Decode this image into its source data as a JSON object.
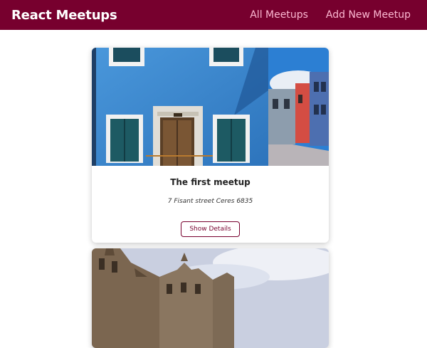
{
  "header": {
    "logo": "React Meetups",
    "nav": [
      {
        "label": "All Meetups"
      },
      {
        "label": "Add New Meetup"
      }
    ]
  },
  "meetups": [
    {
      "title": "The first meetup",
      "address": "7 Fisant street Ceres 6835",
      "button_label": "Show Details"
    }
  ],
  "colors": {
    "brand": "#77002e",
    "nav_link": "#fcb8d2"
  }
}
